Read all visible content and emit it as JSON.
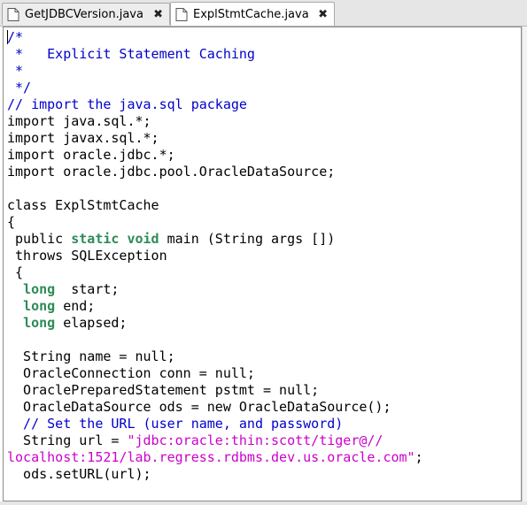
{
  "tabs": [
    {
      "label": "GetJDBCVersion.java",
      "active": false,
      "close": "✖"
    },
    {
      "label": "ExplStmtCache.java",
      "active": true,
      "close": "✖"
    }
  ],
  "colors": {
    "keyword": "#2e8b57",
    "comment": "#0000cc",
    "string": "#cc00cc"
  },
  "code": {
    "lines": [
      [
        {
          "t": "/*",
          "c": "cm"
        }
      ],
      [
        {
          "t": " *   Explicit Statement Caching",
          "c": "cm"
        }
      ],
      [
        {
          "t": " *",
          "c": "cm"
        }
      ],
      [
        {
          "t": " */",
          "c": "cm"
        }
      ],
      [
        {
          "t": "// import the java.sql package",
          "c": "cm"
        }
      ],
      [
        {
          "t": "import java.sql.*;"
        }
      ],
      [
        {
          "t": "import javax.sql.*;"
        }
      ],
      [
        {
          "t": "import oracle.jdbc.*;"
        }
      ],
      [
        {
          "t": "import oracle.jdbc.pool.OracleDataSource;"
        }
      ],
      [
        {
          "t": ""
        }
      ],
      [
        {
          "t": "class ExplStmtCache"
        }
      ],
      [
        {
          "t": "{"
        }
      ],
      [
        {
          "t": " public "
        },
        {
          "t": "static",
          "c": "kw"
        },
        {
          "t": " "
        },
        {
          "t": "void",
          "c": "kw"
        },
        {
          "t": " main (String args [])"
        }
      ],
      [
        {
          "t": " throws SQLException"
        }
      ],
      [
        {
          "t": " {"
        }
      ],
      [
        {
          "t": "  "
        },
        {
          "t": "long",
          "c": "kw"
        },
        {
          "t": "  start;"
        }
      ],
      [
        {
          "t": "  "
        },
        {
          "t": "long",
          "c": "kw"
        },
        {
          "t": " end;"
        }
      ],
      [
        {
          "t": "  "
        },
        {
          "t": "long",
          "c": "kw"
        },
        {
          "t": " elapsed;"
        }
      ],
      [
        {
          "t": ""
        }
      ],
      [
        {
          "t": "  String name = null;"
        }
      ],
      [
        {
          "t": "  OracleConnection conn = null;"
        }
      ],
      [
        {
          "t": "  OraclePreparedStatement pstmt = null;"
        }
      ],
      [
        {
          "t": "  OracleDataSource ods = new OracleDataSource();"
        }
      ],
      [
        {
          "t": "  // Set the URL (user name, and password)",
          "c": "cm"
        }
      ],
      [
        {
          "t": "  String url = "
        },
        {
          "t": "\"jdbc:oracle:thin:scott/tiger@//",
          "c": "str"
        }
      ],
      [
        {
          "t": "localhost:1521/lab.regress.rdbms.dev.us.oracle.com\"",
          "c": "str"
        },
        {
          "t": ";"
        }
      ],
      [
        {
          "t": "  ods.setURL(url);"
        }
      ]
    ]
  }
}
